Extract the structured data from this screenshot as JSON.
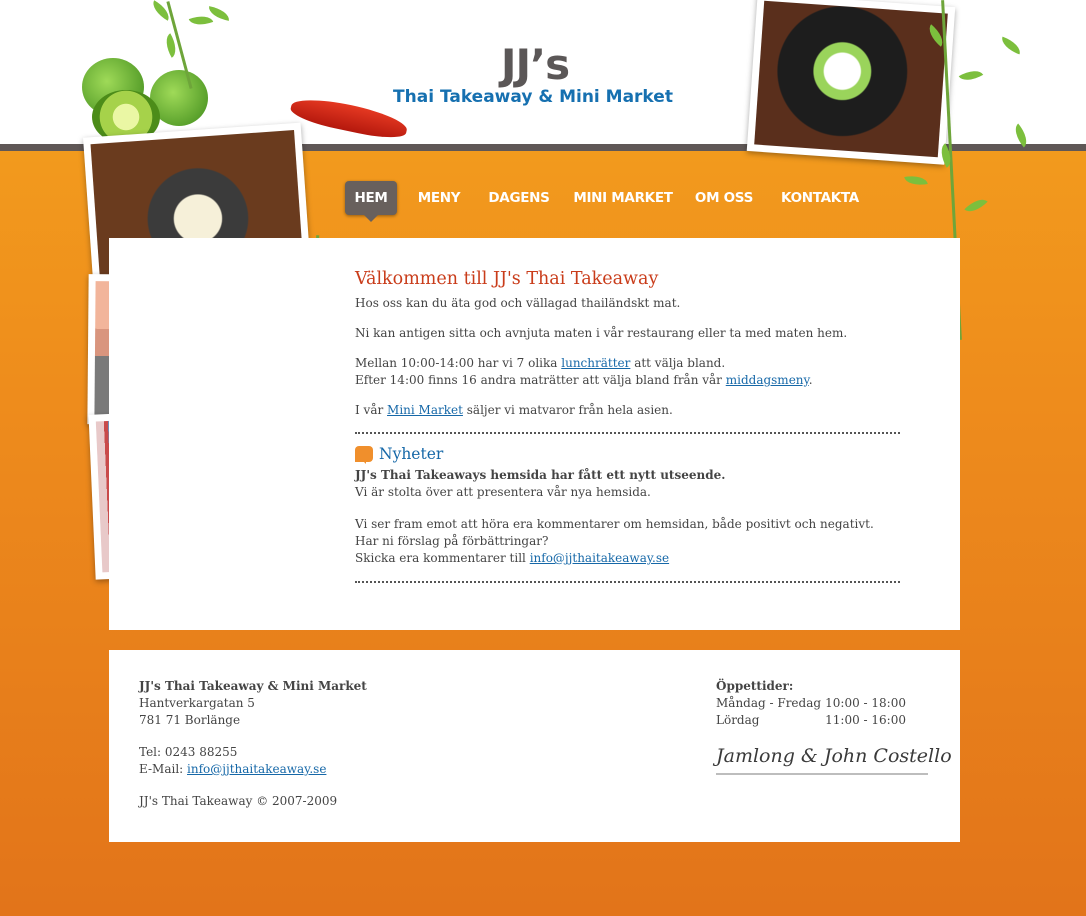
{
  "logo": {
    "title": "JJ’s",
    "subtitle": "Thai Takeaway & Mini Market"
  },
  "nav": [
    {
      "label": "HEM",
      "active": true
    },
    {
      "label": "MENY"
    },
    {
      "label": "DAGENS"
    },
    {
      "label": "MINI MARKET"
    },
    {
      "label": "OM OSS"
    },
    {
      "label": "KONTAKTA"
    }
  ],
  "welcome": {
    "heading": "Välkommen till JJ's Thai Takeaway",
    "p1": "Hos oss kan du äta god och vällagad thailändskt mat.",
    "p2": "Ni kan antigen sitta och avnjuta maten i vår restaurang eller ta med maten hem.",
    "p3_pre": "Mellan 10:00-14:00 har vi 7 olika ",
    "p3_link": "lunchrätter",
    "p3_post": " att välja bland.",
    "p4_pre": "Efter 14:00 finns 16 andra maträtter att välja bland från vår ",
    "p4_link": "middagsmeny",
    "p4_post": ".",
    "p5_pre": "I vår ",
    "p5_link": "Mini Market",
    "p5_post": " säljer vi matvaror från hela asien."
  },
  "news": {
    "heading": "Nyheter",
    "title": "JJ's Thai Takeaways hemsida har fått ett nytt utseende.",
    "line1": "Vi är stolta över att presentera vår nya hemsida.",
    "line2": "Vi ser fram emot att höra era kommentarer om hemsidan, både positivt och negativt.",
    "line3": "Har ni förslag på förbättringar?",
    "line4_pre": "Skicka era kommentarer till ",
    "line4_link": "info@jjthaitakeaway.se"
  },
  "footer": {
    "name": "JJ's Thai Takeaway & Mini Market",
    "street": "Hantverkargatan 5",
    "city": "781 71  Borlänge",
    "tel": "Tel: 0243 88255",
    "email_label": "E-Mail: ",
    "email": "info@jjthaitakeaway.se",
    "copyright": "JJ's Thai Takeaway © 2007-2009",
    "hours_heading": "Öppettider:",
    "hours": [
      {
        "days": "Måndag - Fredag",
        "time": "10:00 - 18:00"
      },
      {
        "days": "Lördag",
        "time": "11:00 - 16:00"
      }
    ],
    "signature": "Jamlong & John Costello"
  },
  "colors": {
    "orange": "#f29a1d",
    "brand_blue": "#1670b0",
    "heading_red": "#c93c1a",
    "nav_active": "#68605d"
  }
}
